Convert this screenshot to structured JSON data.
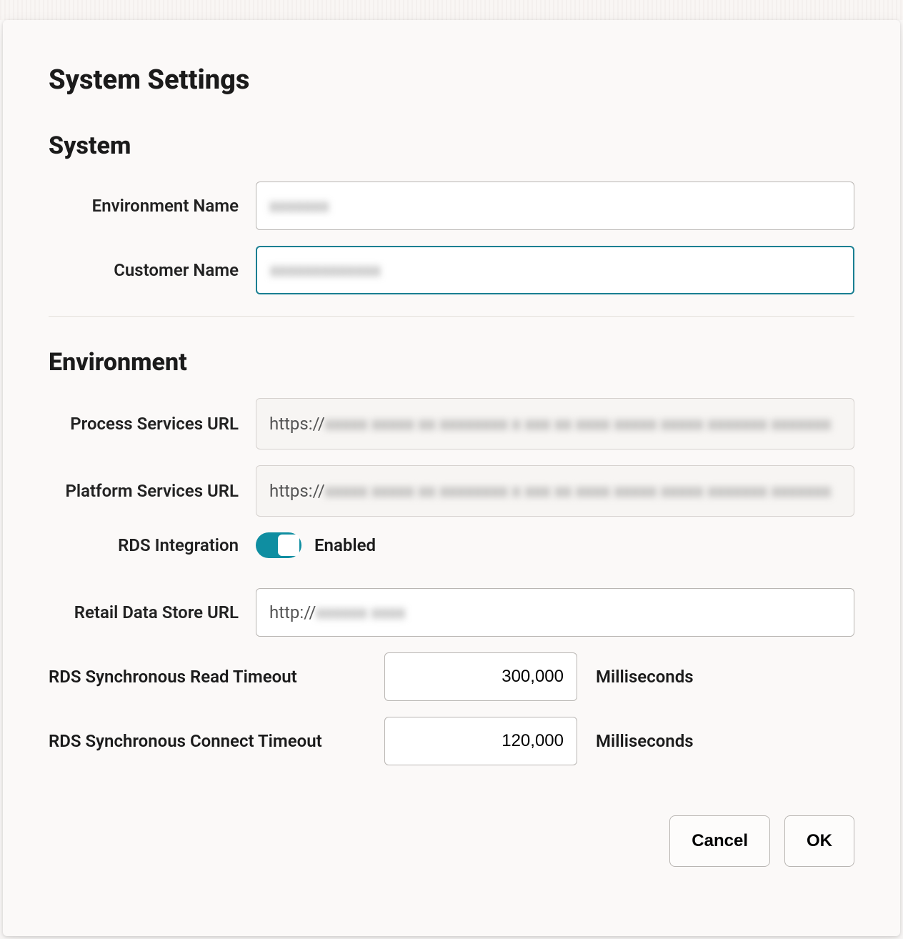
{
  "dialog": {
    "title": "System Settings"
  },
  "sections": {
    "system": {
      "title": "System",
      "environment_name": {
        "label": "Environment Name",
        "value": ""
      },
      "customer_name": {
        "label": "Customer Name",
        "value": ""
      }
    },
    "environment": {
      "title": "Environment",
      "process_services_url": {
        "label": "Process Services URL",
        "prefix": "https://",
        "value": ""
      },
      "platform_services_url": {
        "label": "Platform Services URL",
        "prefix": "https://",
        "value": ""
      },
      "rds_integration": {
        "label": "RDS Integration",
        "state_label": "Enabled",
        "enabled": true
      },
      "retail_data_store_url": {
        "label": "Retail Data Store URL",
        "prefix": "http://",
        "value": ""
      },
      "rds_sync_read_timeout": {
        "label": "RDS Synchronous Read Timeout",
        "value": "300,000",
        "unit": "Milliseconds"
      },
      "rds_sync_connect_timeout": {
        "label": "RDS Synchronous Connect Timeout",
        "value": "120,000",
        "unit": "Milliseconds"
      }
    }
  },
  "buttons": {
    "cancel": "Cancel",
    "ok": "OK"
  }
}
